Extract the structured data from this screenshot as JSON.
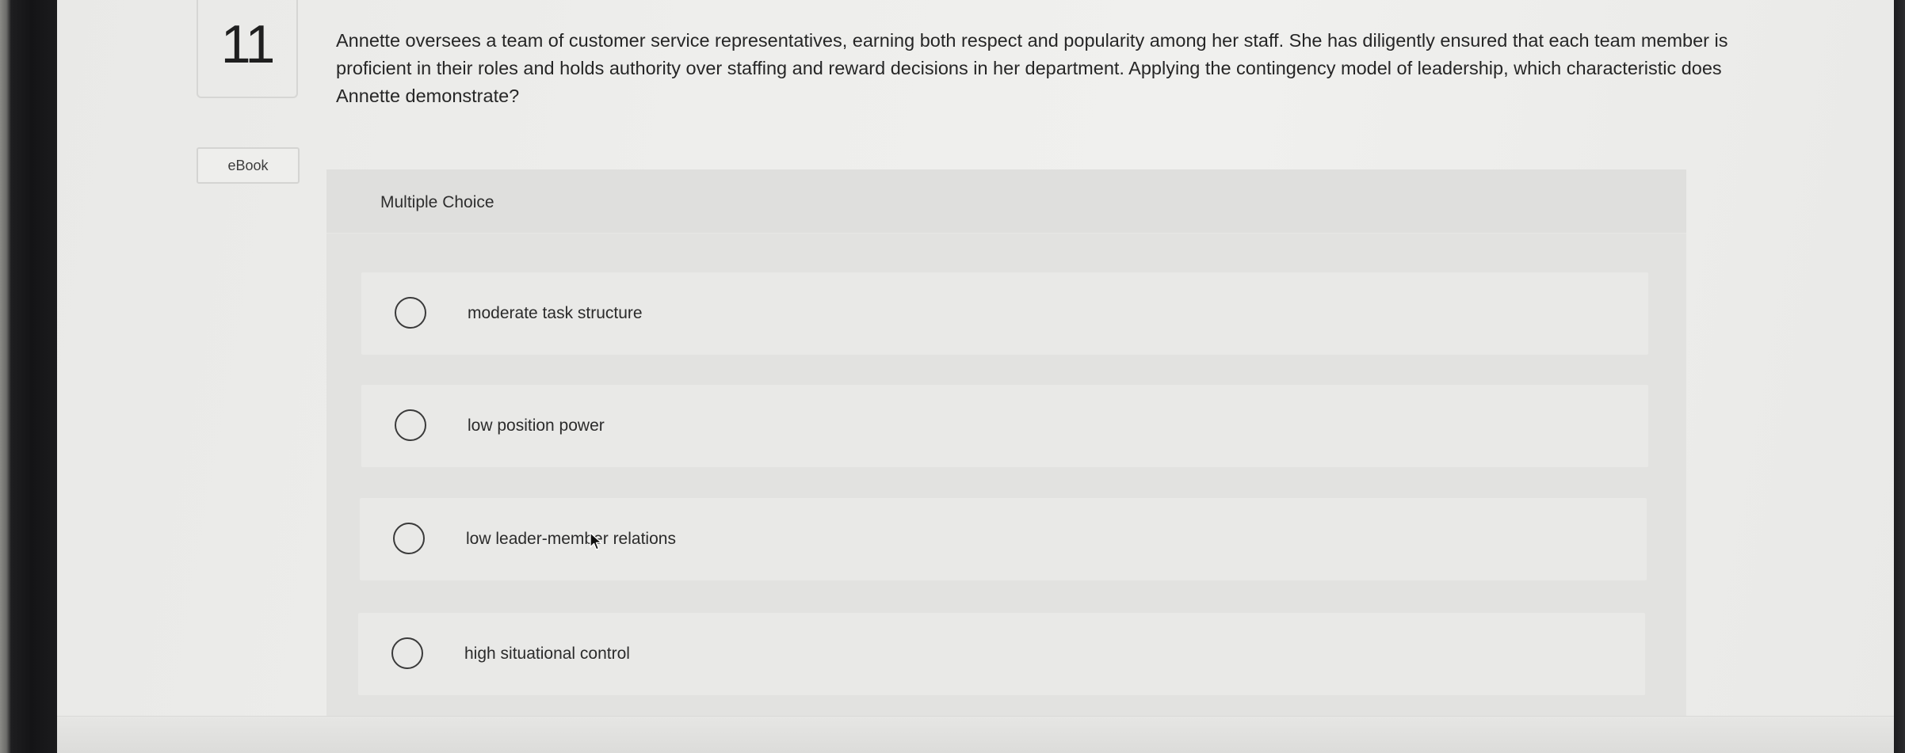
{
  "question": {
    "number": "11",
    "text": "Annette oversees a team of customer service representatives, earning both respect and popularity among her staff. She has diligently ensured that each team member is proficient in their roles and holds authority over staffing and reward decisions in her department. Applying the contingency model of leadership, which characteristic does Annette demonstrate?"
  },
  "ebook": {
    "label": "eBook"
  },
  "multiple_choice": {
    "title": "Multiple Choice",
    "options": [
      {
        "label": "moderate task structure",
        "selected": false
      },
      {
        "label": "low position power",
        "selected": false
      },
      {
        "label": "low leader-member relations",
        "selected": false
      },
      {
        "label": "high situational control",
        "selected": false
      }
    ]
  },
  "icons": {
    "pointer": "mouse-pointer-icon",
    "radio": "radio-circle-icon"
  }
}
